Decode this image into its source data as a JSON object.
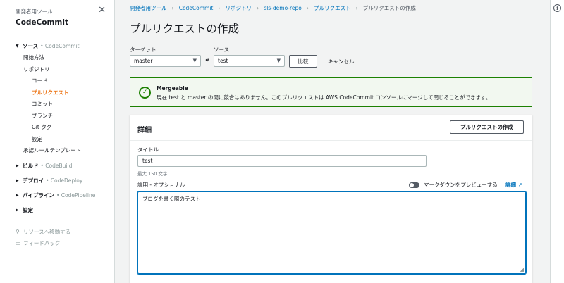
{
  "sidebar": {
    "subtitle": "開発者用ツール",
    "title": "CodeCommit",
    "close_icon": "close-icon",
    "groups": [
      {
        "label": "ソース",
        "service": "• CodeCommit",
        "expanded": true
      },
      {
        "label": "ビルド",
        "service": "• CodeBuild",
        "expanded": false
      },
      {
        "label": "デプロイ",
        "service": "• CodeDeploy",
        "expanded": false
      },
      {
        "label": "パイプライン",
        "service": "• CodePipeline",
        "expanded": false
      },
      {
        "label": "設定",
        "service": "",
        "expanded": false
      }
    ],
    "source_items": {
      "getting_started": "開始方法",
      "repositories": "リポジトリ",
      "code": "コード",
      "pull_requests": "プルリクエスト",
      "commits": "コミット",
      "branches": "ブランチ",
      "git_tags": "Git タグ",
      "settings": "設定",
      "approval_templates": "承認ルールテンプレート"
    },
    "links": {
      "goto_resource": "リソースへ移動する",
      "feedback": "フィードバック"
    }
  },
  "breadcrumbs": [
    "開発者用ツール",
    "CodeCommit",
    "リポジトリ",
    "sls-demo-repo",
    "プルリクエスト",
    "プルリクエストの作成"
  ],
  "page_title": "プルリクエストの作成",
  "compare": {
    "target_label": "ターゲット",
    "target_value": "master",
    "source_label": "ソース",
    "source_value": "test",
    "swap_glyph": "«",
    "compare_button": "比較",
    "cancel": "キャンセル"
  },
  "alert": {
    "title": "Mergeable",
    "message": "現在 test と master の間に競合はありません。このプルリクエストは AWS CodeCommit コンソールにマージして閉じることができます。",
    "color": "#1d8102"
  },
  "details": {
    "title": "詳細",
    "create_button": "プルリクエストの作成",
    "title_label": "タイトル",
    "title_value": "test",
    "title_hint": "最大 150 文字",
    "desc_label": "説明 - オプショナル",
    "preview_toggle": "マークダウンをプレビューする",
    "preview_on": false,
    "detail_link": "詳細",
    "desc_value": "ブログを書く際のテスト"
  },
  "colors": {
    "accent": "#ec7211",
    "link": "#0073bb"
  }
}
